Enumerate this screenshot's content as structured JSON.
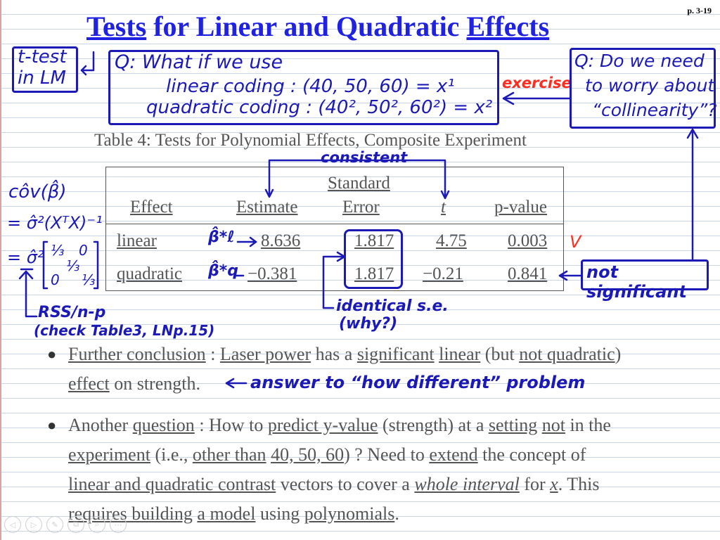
{
  "page_number": "p. 3-19",
  "title": {
    "part1": "Tests",
    "part2": " for Linear and Quadratic ",
    "part3": "Effects"
  },
  "notes": {
    "ttest_line1": "t-test",
    "ttest_line2": "in LM",
    "q1_line1": "Q: What if we use",
    "q1_line2": "linear coding : (40, 50, 60) = x¹",
    "q1_line3": "quadratic coding : (40², 50², 60²) = x²",
    "exercise": "exercise",
    "q2_line1": "Q: Do we need",
    "q2_line2": "to worry about",
    "q2_line3": "“collinearity”?",
    "consistent": "consistent",
    "cov_line1": "côv(β̂)",
    "cov_line2": "= σ̂²(XᵀX)⁻¹",
    "cov_line3": "= σ̂²",
    "matrix_a": "⅓",
    "matrix_b": "0",
    "matrix_c": "⅓",
    "matrix_d": "0",
    "matrix_e": "⅓",
    "beta_l": "β̂*ℓ",
    "beta_q": "β̂*q",
    "v_mark": "V",
    "not_significant": "not significant",
    "identical_se": "identical s.e.",
    "why": "(why?)",
    "rss": "RSS/n-p",
    "check_table": "(check Table3, LNp.15)",
    "answer_to": "answer to “how different” problem"
  },
  "table": {
    "caption": "Table 4: Tests for Polynomial Effects, Composite Experiment",
    "header_standard": "Standard",
    "headers": [
      "Effect",
      "Estimate",
      "Error",
      "t",
      "p-value"
    ],
    "rows": [
      {
        "effect": "linear",
        "estimate": "8.636",
        "error": "1.817",
        "t": "4.75",
        "p": "0.003"
      },
      {
        "effect": "quadratic",
        "estimate": "−0.381",
        "error": "1.817",
        "t": "−0.21",
        "p": "0.841"
      }
    ]
  },
  "bullets": {
    "b1": {
      "w1": "Further conclusion",
      "t1": " : ",
      "w2": "Laser power",
      "t2": " has a ",
      "w3": "significant",
      "t3": " ",
      "w4": "linear",
      "t4": " (but ",
      "w5": "not quadratic",
      "t5": ")",
      "w6": "effect",
      "t6": " on strength."
    },
    "b2": {
      "t0": "Another ",
      "w1": "question",
      "t1": " : How to ",
      "w2": "predict y-value",
      "t2": " (strength) at a ",
      "w3": "setting",
      "t3": " ",
      "w4": "not",
      "t4": " in the",
      "w5": "experiment",
      "t5": " (i.e., ",
      "w6": "other than",
      "t6": " ",
      "w7": "40, 50, 60",
      "t7": ") ? Need to ",
      "w8": "extend",
      "t8": " the concept of",
      "w9": "linear and quadratic contrast",
      "t9": " vectors to cover a ",
      "w10": "whole interval",
      "t10": " for ",
      "w11": "x",
      "t11": ". This",
      "w12": "requires building",
      "t12": " ",
      "w13": "a model",
      "t13": " using ",
      "w14": "polynomials",
      "t14": "."
    }
  },
  "toolbar": [
    "◁",
    "▷",
    "✎",
    "⧉",
    "⌕",
    "⋯"
  ],
  "colors": {
    "title": "#1f22e0",
    "ink_blue": "#1b1ab7",
    "ink_red": "#ff2d1f",
    "body_text": "#555555",
    "ruled_line": "#c9d6ea"
  }
}
